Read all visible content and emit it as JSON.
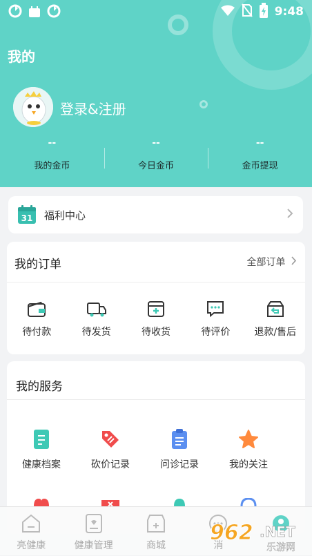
{
  "status_bar": {
    "time": "9:48"
  },
  "header": {
    "title": "我的",
    "login_label": "登录&注册",
    "stats": [
      {
        "value": "--",
        "label": "我的金币"
      },
      {
        "value": "--",
        "label": "今日金币"
      },
      {
        "value": "--",
        "label": "金币提现"
      }
    ]
  },
  "welfare": {
    "calendar_day": "31",
    "label": "福利中心"
  },
  "orders": {
    "title": "我的订单",
    "all_label": "全部订单",
    "items": [
      {
        "label": "待付款",
        "icon": "wallet-icon"
      },
      {
        "label": "待发货",
        "icon": "truck-icon"
      },
      {
        "label": "待收货",
        "icon": "box-icon"
      },
      {
        "label": "待评价",
        "icon": "comment-icon"
      },
      {
        "label": "退款/售后",
        "icon": "return-icon"
      }
    ]
  },
  "services": {
    "title": "我的服务",
    "items": [
      {
        "label": "健康档案",
        "icon": "health-record-icon",
        "color": "#3ec9b5"
      },
      {
        "label": "砍价记录",
        "icon": "price-tag-icon",
        "color": "#f04c4c"
      },
      {
        "label": "问诊记录",
        "icon": "clipboard-icon",
        "color": "#5b8ff0"
      },
      {
        "label": "我的关注",
        "icon": "star-icon",
        "color": "#ff8a3d"
      }
    ]
  },
  "tabbar": {
    "items": [
      {
        "label": "亮健康",
        "icon": "home-icon"
      },
      {
        "label": "健康管理",
        "icon": "health-manage-icon"
      },
      {
        "label": "商城",
        "icon": "shop-icon"
      },
      {
        "label": "消",
        "icon": "message-icon"
      },
      {
        "label": "",
        "icon": "profile-icon"
      }
    ]
  },
  "watermark": {
    "brand": "962",
    "domain": ".NET",
    "subtitle": "乐游网"
  },
  "colors": {
    "accent": "#5fd3c7",
    "background": "#f2f3f5"
  }
}
